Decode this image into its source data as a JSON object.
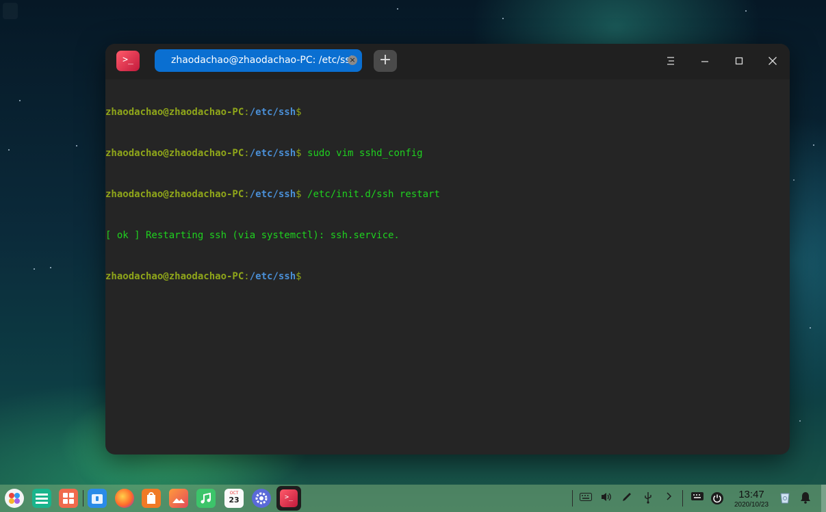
{
  "window": {
    "app_icon_glyph": ">_",
    "tab_title": "zhaodachao@zhaodachao-PC: /etc/ssh",
    "tab_close_glyph": "×",
    "new_tab_glyph": "+",
    "menu_icon": "hamburger-menu-icon",
    "minimize_icon": "minimize-icon",
    "maximize_icon": "maximize-icon",
    "close_icon": "close-icon"
  },
  "terminal": {
    "lines": [
      {
        "user": "zhaodachao@zhaodachao-PC",
        "sep": ":",
        "path": "/etc/ssh",
        "dollar": "$",
        "cmd": ""
      },
      {
        "user": "zhaodachao@zhaodachao-PC",
        "sep": ":",
        "path": "/etc/ssh",
        "dollar": "$",
        "cmd": " sudo vim sshd_config"
      },
      {
        "user": "zhaodachao@zhaodachao-PC",
        "sep": ":",
        "path": "/etc/ssh",
        "dollar": "$",
        "cmd": " /etc/init.d/ssh restart"
      },
      {
        "output": "[ ok ] Restarting ssh (via systemctl): ssh.service."
      },
      {
        "user": "zhaodachao@zhaodachao-PC",
        "sep": ":",
        "path": "/etc/ssh",
        "dollar": "$",
        "cmd": ""
      }
    ]
  },
  "taskbar": {
    "apps": [
      {
        "name": "launcher-icon"
      },
      {
        "name": "show-desktop-icon"
      },
      {
        "name": "multitask-view-icon"
      },
      {
        "name": "file-manager-icon"
      },
      {
        "name": "firefox-icon"
      },
      {
        "name": "app-store-icon"
      },
      {
        "name": "image-viewer-icon"
      },
      {
        "name": "music-icon"
      },
      {
        "name": "calendar-icon"
      },
      {
        "name": "control-center-icon"
      },
      {
        "name": "terminal-icon"
      }
    ],
    "calendar_month": "OCT",
    "calendar_day": "23",
    "tray": [
      "keyboard-icon",
      "volume-icon",
      "pen-icon",
      "usb-icon",
      "expand-arrow-icon"
    ],
    "clock_time": "13:47",
    "clock_date": "2020/10/23"
  },
  "colors": {
    "prompt_user": "#8fa61a",
    "prompt_path": "#4a8fd6",
    "command_text": "#1fd11f",
    "tab_active": "#0a6fd1",
    "terminal_bg": "#252525"
  }
}
